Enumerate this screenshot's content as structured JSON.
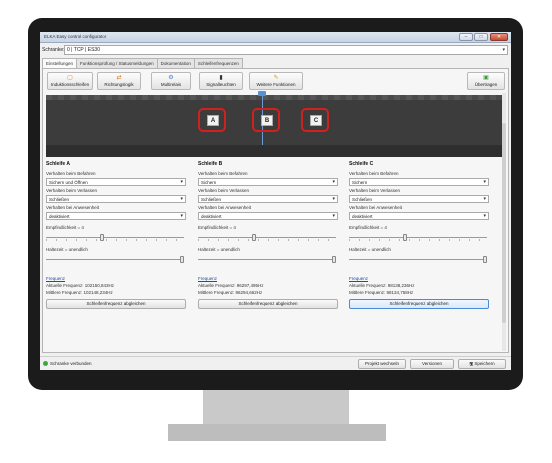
{
  "window": {
    "title": "ELKA Easy control configurator",
    "minimize": "–",
    "maximize": "□",
    "close": "✕"
  },
  "barrier": {
    "label": "Schranke:",
    "value": "0 | TCP | ES30"
  },
  "tabs": [
    {
      "label": "Einstellungen"
    },
    {
      "label": "Funktionsprüfung / Statusmeldungen"
    },
    {
      "label": "Dokumentation"
    },
    {
      "label": "Schleifenfrequenzen"
    }
  ],
  "toolbar": {
    "induction": "Induktionsschleifen",
    "direction": "Richtungslogik",
    "multirelay": "Multirelais",
    "signals": "Signalleuchten",
    "more": "Weitere Funktionen",
    "transfer": "Übertragen"
  },
  "diagram": {
    "loops": [
      "A",
      "B",
      "C"
    ]
  },
  "loop_panels": [
    {
      "title": "Schleife A",
      "drive_label": "Verhalten beim Befahren",
      "drive_value": "Sichern und Öffnen",
      "leave_label": "Verhalten beim Verlassen",
      "leave_value": "Schließen",
      "presence_label": "Verhalten bei Anwesenheit",
      "presence_value": "deaktiviert",
      "sensitivity_label": "Empfindlichkeit = 4",
      "sensitivity_level": 0.4,
      "hold_label": "Haltezeit = unendlich",
      "hold_level": 1.0,
      "freq_head": "Frequenz",
      "freq_current": "Aktuelle Frequenz: 102150,843Hz",
      "freq_mean": "Mittlere Frequenz: 102148,234Hz",
      "align": "Schleifenfrequenz abgleichen"
    },
    {
      "title": "Schleife B",
      "drive_label": "Verhalten beim Befahren",
      "drive_value": "Sichern",
      "leave_label": "Verhalten beim Verlassen",
      "leave_value": "Schließen",
      "presence_label": "Verhalten bei Anwesenheit",
      "presence_value": "deaktiviert",
      "sensitivity_label": "Empfindlichkeit = 4",
      "sensitivity_level": 0.4,
      "hold_label": "Haltezeit = unendlich",
      "hold_level": 1.0,
      "freq_head": "Frequenz",
      "freq_current": "Aktuelle Frequenz: 96297,495Hz",
      "freq_mean": "Mittlere Frequenz: 96294,662Hz",
      "align": "Schleifenfrequenz abgleichen"
    },
    {
      "title": "Schleife C",
      "drive_label": "Verhalten beim Befahren",
      "drive_value": "Sichern",
      "leave_label": "Verhalten beim Verlassen",
      "leave_value": "Schließen",
      "presence_label": "Verhalten bei Anwesenheit",
      "presence_value": "deaktiviert",
      "sensitivity_label": "Empfindlichkeit = 4",
      "sensitivity_level": 0.4,
      "hold_label": "Haltezeit = unendlich",
      "hold_level": 1.0,
      "freq_head": "Frequenz",
      "freq_current": "Aktuelle Frequenz: 98138,236Hz",
      "freq_mean": "Mittlere Frequenz: 98134,758Hz",
      "align": "Schleifenfrequenz abgleichen"
    }
  ],
  "status": {
    "text": "Schranke verbunden",
    "dot_color": "#3ea83a",
    "project_button": "Projekt wechseln",
    "versions_button": "Versionen",
    "save_button": "Speichern"
  },
  "colors": {
    "loop_frame": "#d0211c",
    "accent": "#4a8bd6"
  },
  "icons": {
    "induction": "loop-icon",
    "direction": "direction-icon",
    "multirelay": "relay-icon",
    "signals": "signal-light-icon",
    "more": "wrench-icon",
    "transfer": "transfer-icon",
    "save": "floppy-icon"
  }
}
